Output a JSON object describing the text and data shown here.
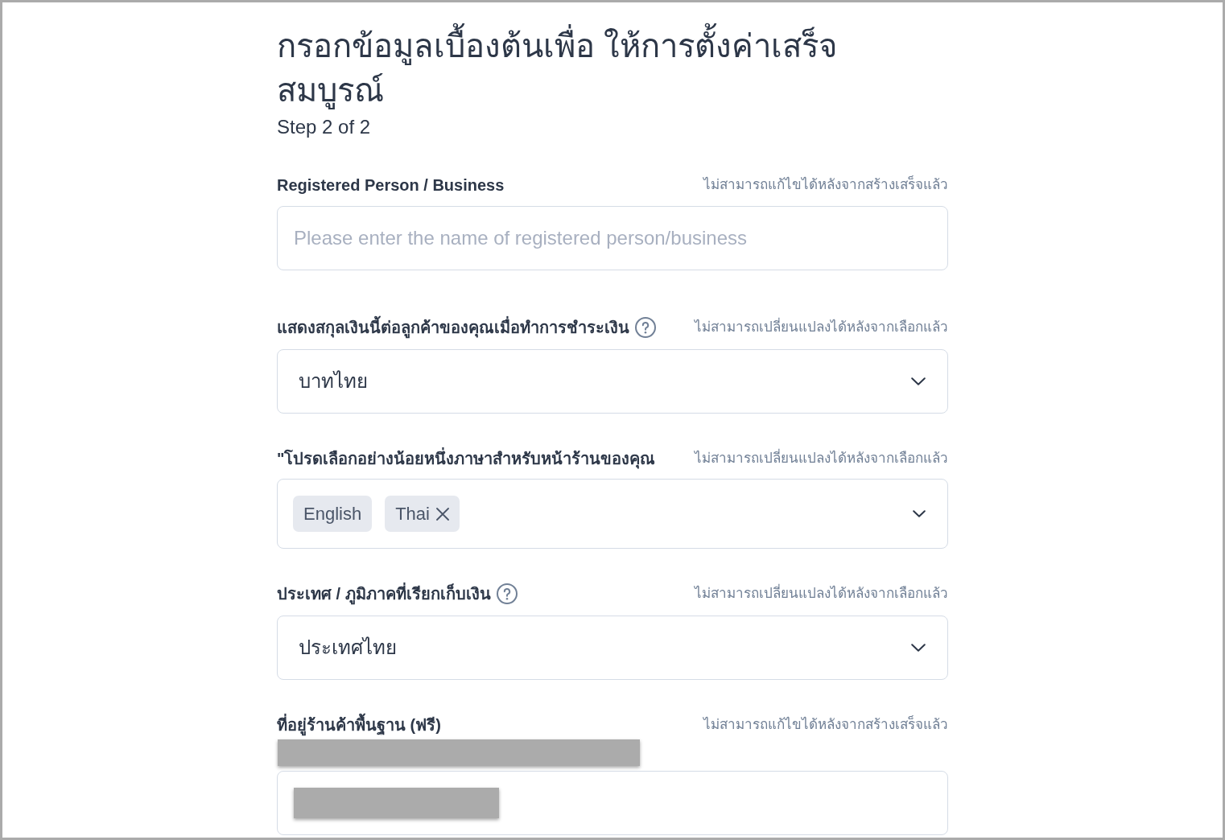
{
  "heading": {
    "title": "กรอกข้อมูลเบื้องต้นเพื่อ ให้การตั้งค่าเสร็จสมบูรณ์",
    "step": "Step 2 of 2"
  },
  "fields": [
    {
      "kind": "text",
      "label": "Registered Person / Business",
      "help": false,
      "note": "ไม่สามารถแก้ไขได้หลังจากสร้างเสร็จแล้ว",
      "placeholder": "Please enter the name of registered person/business"
    },
    {
      "kind": "select",
      "label": "แสดงสกุลเงินนี้ต่อลูกค้าของคุณเมื่อทำการชำระเงิน",
      "help": true,
      "note": "ไม่สามารถเปลี่ยนแปลงได้หลังจากเลือกแล้ว",
      "value": "บาทไทย"
    },
    {
      "kind": "multiselect",
      "label": "\"โปรดเลือกอย่างน้อยหนึ่งภาษาสำหรับหน้าร้านของคุณ",
      "help": false,
      "note": "ไม่สามารถเปลี่ยนแปลงได้หลังจากเลือกแล้ว",
      "tags": [
        {
          "label": "English",
          "removable": false
        },
        {
          "label": "Thai",
          "removable": true
        }
      ]
    },
    {
      "kind": "select",
      "label": "ประเทศ / ภูมิภาคที่เรียกเก็บเงิน",
      "help": true,
      "note": "ไม่สามารถเปลี่ยนแปลงได้หลังจากเลือกแล้ว",
      "value": "ประเทศไทย"
    },
    {
      "kind": "redacted",
      "label": "ที่อยู่ร้านค้าพื้นฐาน (ฟรี)",
      "help": false,
      "note": "ไม่สามารถแก้ไขได้หลังจากสร้างเสร็จแล้ว"
    }
  ]
}
